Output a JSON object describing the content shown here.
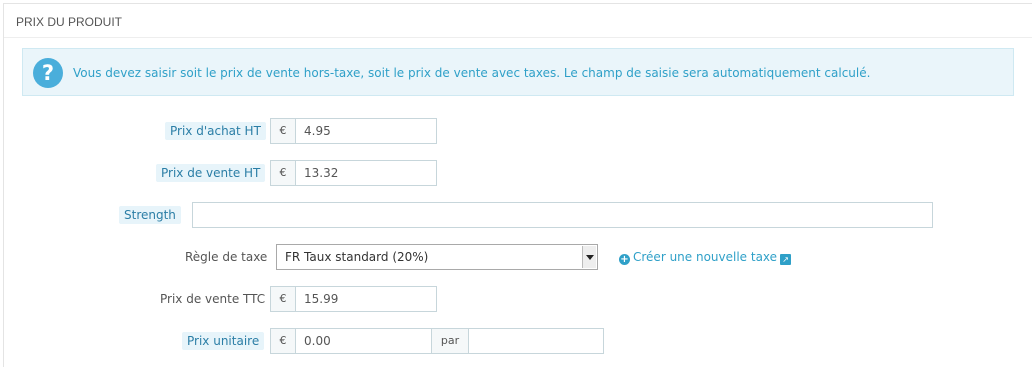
{
  "panel": {
    "title": "PRIX DU PRODUIT"
  },
  "alert": {
    "icon": "question-circle-icon",
    "text": "Vous devez saisir soit le prix de vente hors-taxe, soit le prix de vente avec taxes. Le champ de saisie sera automatiquement calculé."
  },
  "fields": {
    "wholesale_price": {
      "label": "Prix d'achat HT",
      "currency": "€",
      "value": "4.95"
    },
    "price_excl": {
      "label": "Prix de vente HT",
      "currency": "€",
      "value": "13.32"
    },
    "strength": {
      "label": "Strength",
      "value": ""
    },
    "tax_rule": {
      "label": "Règle de taxe",
      "selected": "FR Taux standard (20%)"
    },
    "create_tax": {
      "label": "Créer une nouvelle taxe",
      "icon": "plus-circle-icon",
      "ext_icon": "external-link-icon"
    },
    "price_incl": {
      "label": "Prix de vente TTC",
      "currency": "€",
      "value": "15.99"
    },
    "unit_price": {
      "label": "Prix unitaire",
      "currency": "€",
      "value": "0.00",
      "per_label": "par",
      "unity": ""
    }
  },
  "colors": {
    "accent": "#2fa0c8",
    "alert_bg": "#eaf5fa",
    "hint_bg": "#e7f4fa"
  }
}
